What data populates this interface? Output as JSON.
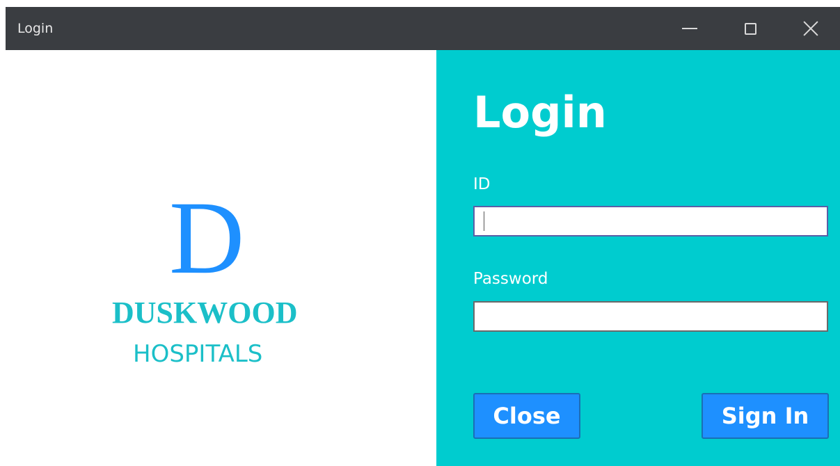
{
  "window": {
    "title": "Login"
  },
  "brand": {
    "logo_letter": "D",
    "name": "DUSKWOOD",
    "subtitle": "HOSPITALS"
  },
  "form": {
    "heading": "Login",
    "id_label": "ID",
    "id_value": "",
    "password_label": "Password",
    "password_value": "",
    "close_label": "Close",
    "signin_label": "Sign In"
  },
  "colors": {
    "titlebar": "#3a3d41",
    "panel": "#00cccf",
    "button": "#1e90ff",
    "logo_letter": "#1e90ff",
    "logo_text": "#1bbfc8"
  }
}
